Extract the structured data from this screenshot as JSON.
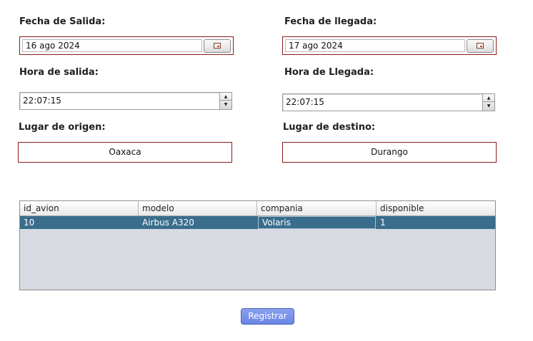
{
  "departure": {
    "date_label": "Fecha de Salida:",
    "date_value": "16 ago 2024",
    "time_label": "Hora de salida:",
    "time_value": "22:07:15",
    "place_label": "Lugar de origen:",
    "place_value": "Oaxaca"
  },
  "arrival": {
    "date_label": "Fecha de llegada:",
    "date_value": "17 ago 2024",
    "time_label": "Hora de Llegada:",
    "time_value": "22:07:15",
    "place_label": "Lugar de destino:",
    "place_value": "Durango"
  },
  "table": {
    "columns": [
      "id_avion",
      "modelo",
      "compania",
      "disponible"
    ],
    "rows": [
      [
        "10",
        "Airbus A320",
        "Volaris",
        "1"
      ]
    ],
    "selected_row": 0
  },
  "register_button": "Registrar",
  "colors": {
    "field_border": "#8b1a1a",
    "row_selected": "#3a6d8c",
    "table_bg": "#d7dae1",
    "button": "#7a93eb"
  },
  "icons": {
    "calendar": "calendar-icon",
    "spin_up": "spinner-up-arrow",
    "spin_down": "spinner-down-arrow"
  }
}
